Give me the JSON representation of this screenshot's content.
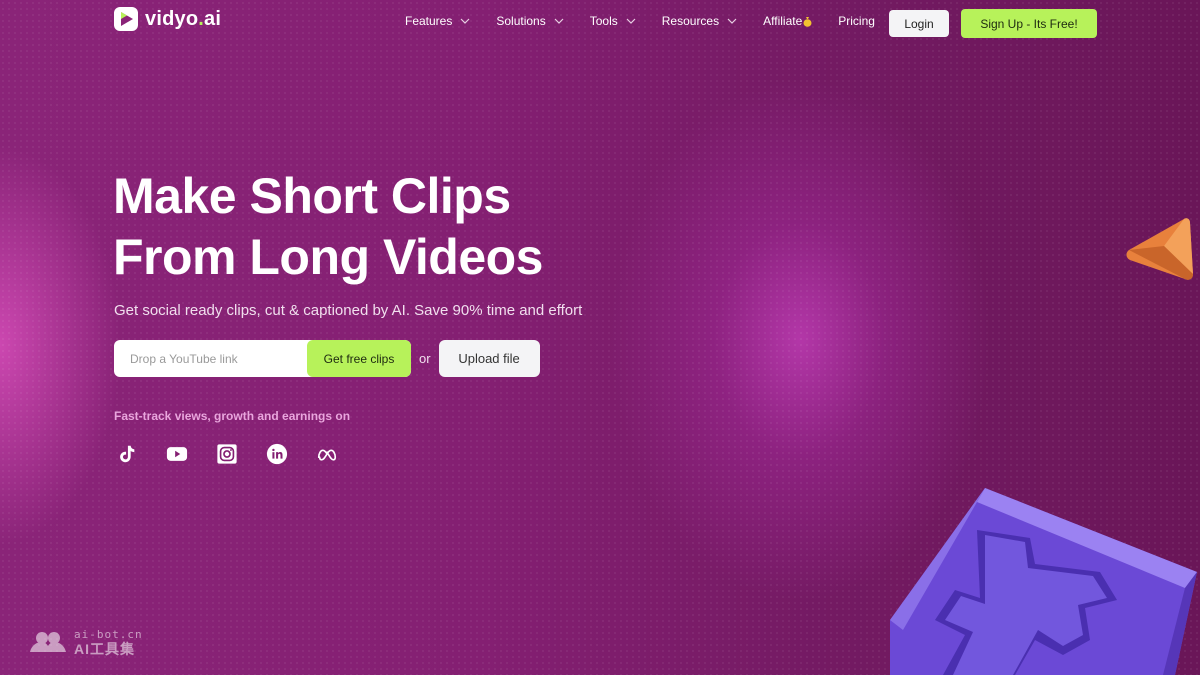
{
  "header": {
    "logo_text_a": "vidyo",
    "logo_text_dot": ".",
    "logo_text_b": "ai",
    "nav": [
      {
        "label": "Features",
        "icon": "chevron-down-icon"
      },
      {
        "label": "Solutions",
        "icon": "chevron-down-icon"
      },
      {
        "label": "Tools",
        "icon": "chevron-down-icon"
      },
      {
        "label": "Resources",
        "icon": "chevron-down-icon"
      },
      {
        "label": "Affiliate",
        "icon": "money-bag-icon"
      },
      {
        "label": "Pricing"
      }
    ],
    "login_label": "Login",
    "signup_label": "Sign Up - Its Free!"
  },
  "hero": {
    "title_line1": "Make Short Clips",
    "title_line2": "From Long Videos",
    "subtitle": "Get social ready clips, cut & captioned by AI. Save 90% time and effort",
    "input_placeholder": "Drop a YouTube link",
    "input_value": "",
    "get_clips_label": "Get free clips",
    "or_text": "or",
    "upload_label": "Upload file"
  },
  "platforms": {
    "heading": "Fast-track views, growth and earnings on",
    "icons": [
      "tiktok-icon",
      "youtube-icon",
      "instagram-icon",
      "linkedin-icon",
      "meta-icon"
    ]
  },
  "watermark": {
    "line1": "ai-bot.cn",
    "line2": "AI工具集"
  },
  "colors": {
    "accent": "#b7f25a",
    "background": "#841f72",
    "button_light": "#f4f4f6"
  }
}
